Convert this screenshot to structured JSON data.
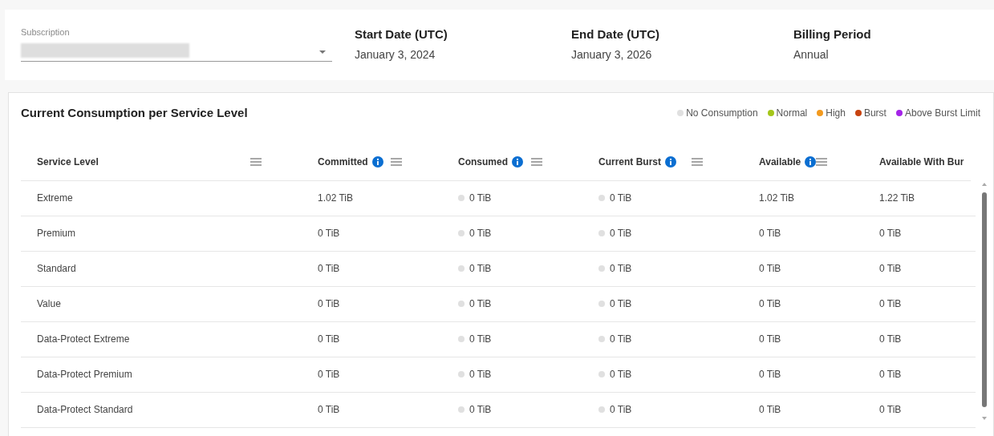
{
  "summary": {
    "subscription": {
      "label": "Subscription"
    },
    "fields": [
      {
        "label": "Start Date (UTC)",
        "value": "January 3, 2024"
      },
      {
        "label": "End Date (UTC)",
        "value": "January 3, 2026"
      },
      {
        "label": "Billing Period",
        "value": "Annual"
      }
    ]
  },
  "panel": {
    "title": "Current Consumption per Service Level",
    "legend": [
      {
        "label": "No Consumption",
        "color": "#e0e0e0"
      },
      {
        "label": "Normal",
        "color": "#a4c61a"
      },
      {
        "label": "High",
        "color": "#f39a1e"
      },
      {
        "label": "Burst",
        "color": "#c8430f"
      },
      {
        "label": "Above Burst Limit",
        "color": "#a424e8"
      }
    ],
    "table": {
      "columns": [
        {
          "label": "Service Level",
          "kind": "sortable"
        },
        {
          "label": "Committed",
          "kind": "described"
        },
        {
          "label": "Consumed",
          "kind": "described"
        },
        {
          "label": "Current Burst",
          "kind": "described"
        },
        {
          "label": "Available",
          "kind": "described"
        },
        {
          "label": "Available With Bur",
          "kind": "plain"
        }
      ],
      "rows": [
        {
          "cells": [
            {
              "text": "Extreme"
            },
            {
              "text": "1.02 TiB"
            },
            {
              "text": "0 TiB",
              "color": "#e0e0e0"
            },
            {
              "text": "0 TiB",
              "color": "#e0e0e0"
            },
            {
              "text": "1.02 TiB"
            },
            {
              "text": "1.22 TiB"
            }
          ]
        },
        {
          "cells": [
            {
              "text": "Premium"
            },
            {
              "text": "0 TiB"
            },
            {
              "text": "0 TiB",
              "color": "#e0e0e0"
            },
            {
              "text": "0 TiB",
              "color": "#e0e0e0"
            },
            {
              "text": "0 TiB"
            },
            {
              "text": "0 TiB"
            }
          ]
        },
        {
          "cells": [
            {
              "text": "Standard"
            },
            {
              "text": "0 TiB"
            },
            {
              "text": "0 TiB",
              "color": "#e0e0e0"
            },
            {
              "text": "0 TiB",
              "color": "#e0e0e0"
            },
            {
              "text": "0 TiB"
            },
            {
              "text": "0 TiB"
            }
          ]
        },
        {
          "cells": [
            {
              "text": "Value"
            },
            {
              "text": "0 TiB"
            },
            {
              "text": "0 TiB",
              "color": "#e0e0e0"
            },
            {
              "text": "0 TiB",
              "color": "#e0e0e0"
            },
            {
              "text": "0 TiB"
            },
            {
              "text": "0 TiB"
            }
          ]
        },
        {
          "cells": [
            {
              "text": "Data-Protect Extreme"
            },
            {
              "text": "0 TiB"
            },
            {
              "text": "0 TiB",
              "color": "#e0e0e0"
            },
            {
              "text": "0 TiB",
              "color": "#e0e0e0"
            },
            {
              "text": "0 TiB"
            },
            {
              "text": "0 TiB"
            }
          ]
        },
        {
          "cells": [
            {
              "text": "Data-Protect Premium"
            },
            {
              "text": "0 TiB"
            },
            {
              "text": "0 TiB",
              "color": "#e0e0e0"
            },
            {
              "text": "0 TiB",
              "color": "#e0e0e0"
            },
            {
              "text": "0 TiB"
            },
            {
              "text": "0 TiB"
            }
          ]
        },
        {
          "cells": [
            {
              "text": "Data-Protect Standard"
            },
            {
              "text": "0 TiB"
            },
            {
              "text": "0 TiB",
              "color": "#e0e0e0"
            },
            {
              "text": "0 TiB",
              "color": "#e0e0e0"
            },
            {
              "text": "0 TiB"
            },
            {
              "text": "0 TiB"
            }
          ]
        }
      ]
    }
  }
}
